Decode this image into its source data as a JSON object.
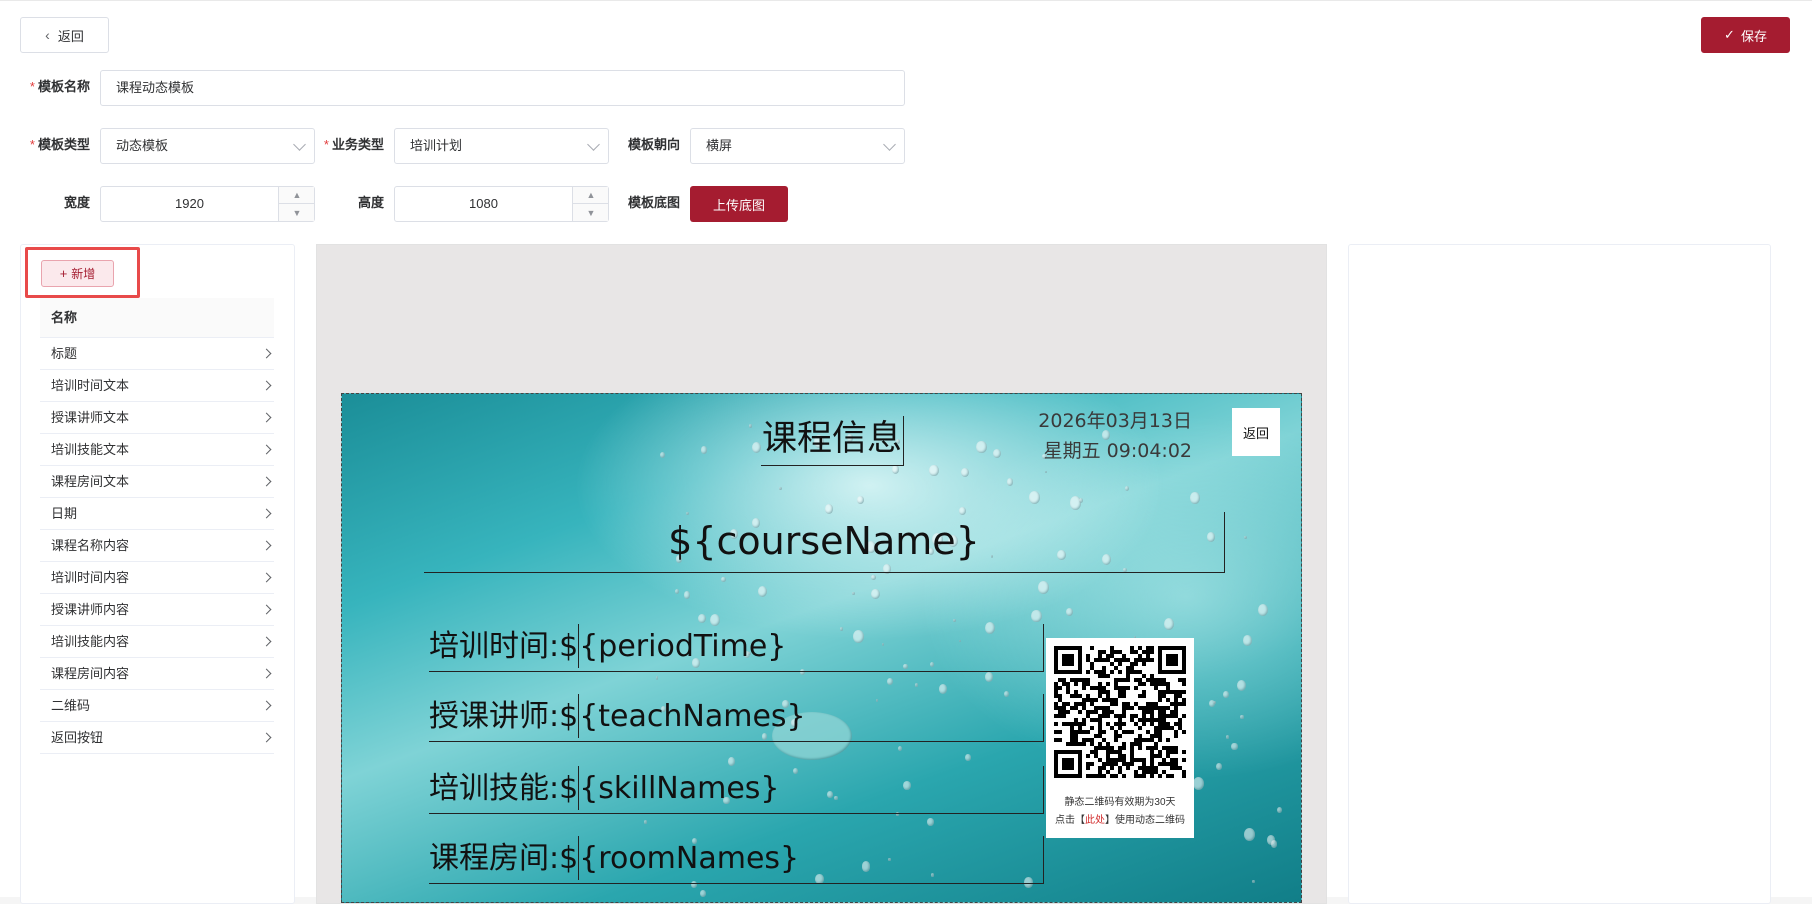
{
  "toolbar": {
    "back_label": "返回",
    "save_label": "保存"
  },
  "form": {
    "template_name": {
      "label": "模板名称",
      "value": "课程动态模板"
    },
    "template_type": {
      "label": "模板类型",
      "value": "动态模板"
    },
    "business_type": {
      "label": "业务类型",
      "value": "培训计划"
    },
    "orientation": {
      "label": "模板朝向",
      "value": "横屏"
    },
    "width": {
      "label": "宽度",
      "value": "1920"
    },
    "height": {
      "label": "高度",
      "value": "1080"
    },
    "background": {
      "label": "模板底图",
      "button_label": "上传底图"
    }
  },
  "left_panel": {
    "add_label": "新增",
    "column_header": "名称",
    "items": [
      "标题",
      "培训时间文本",
      "授课讲师文本",
      "培训技能文本",
      "课程房间文本",
      "日期",
      "课程名称内容",
      "培训时间内容",
      "授课讲师内容",
      "培训技能内容",
      "课程房间内容",
      "二维码",
      "返回按钮"
    ]
  },
  "poster": {
    "title": "课程信息",
    "date": "2026年03月13日",
    "weekday_time": "星期五 09:04:02",
    "back_label": "返回",
    "course_name": "${courseName}",
    "rows": [
      {
        "label": "培训时间:$",
        "value": "{periodTime}"
      },
      {
        "label": "授课讲师:$",
        "value": "{teachNames}"
      },
      {
        "label": "培训技能:$",
        "value": "{skillNames}"
      },
      {
        "label": "课程房间:$",
        "value": "{roomNames}"
      }
    ],
    "qr_caption_line1": "静态二维码有效期为30天",
    "qr_caption_pre": "点击【",
    "qr_caption_link": "此处",
    "qr_caption_post": "】使用动态二维码"
  },
  "colors": {
    "accent": "#a51c30",
    "highlight": "#e84a4a"
  }
}
